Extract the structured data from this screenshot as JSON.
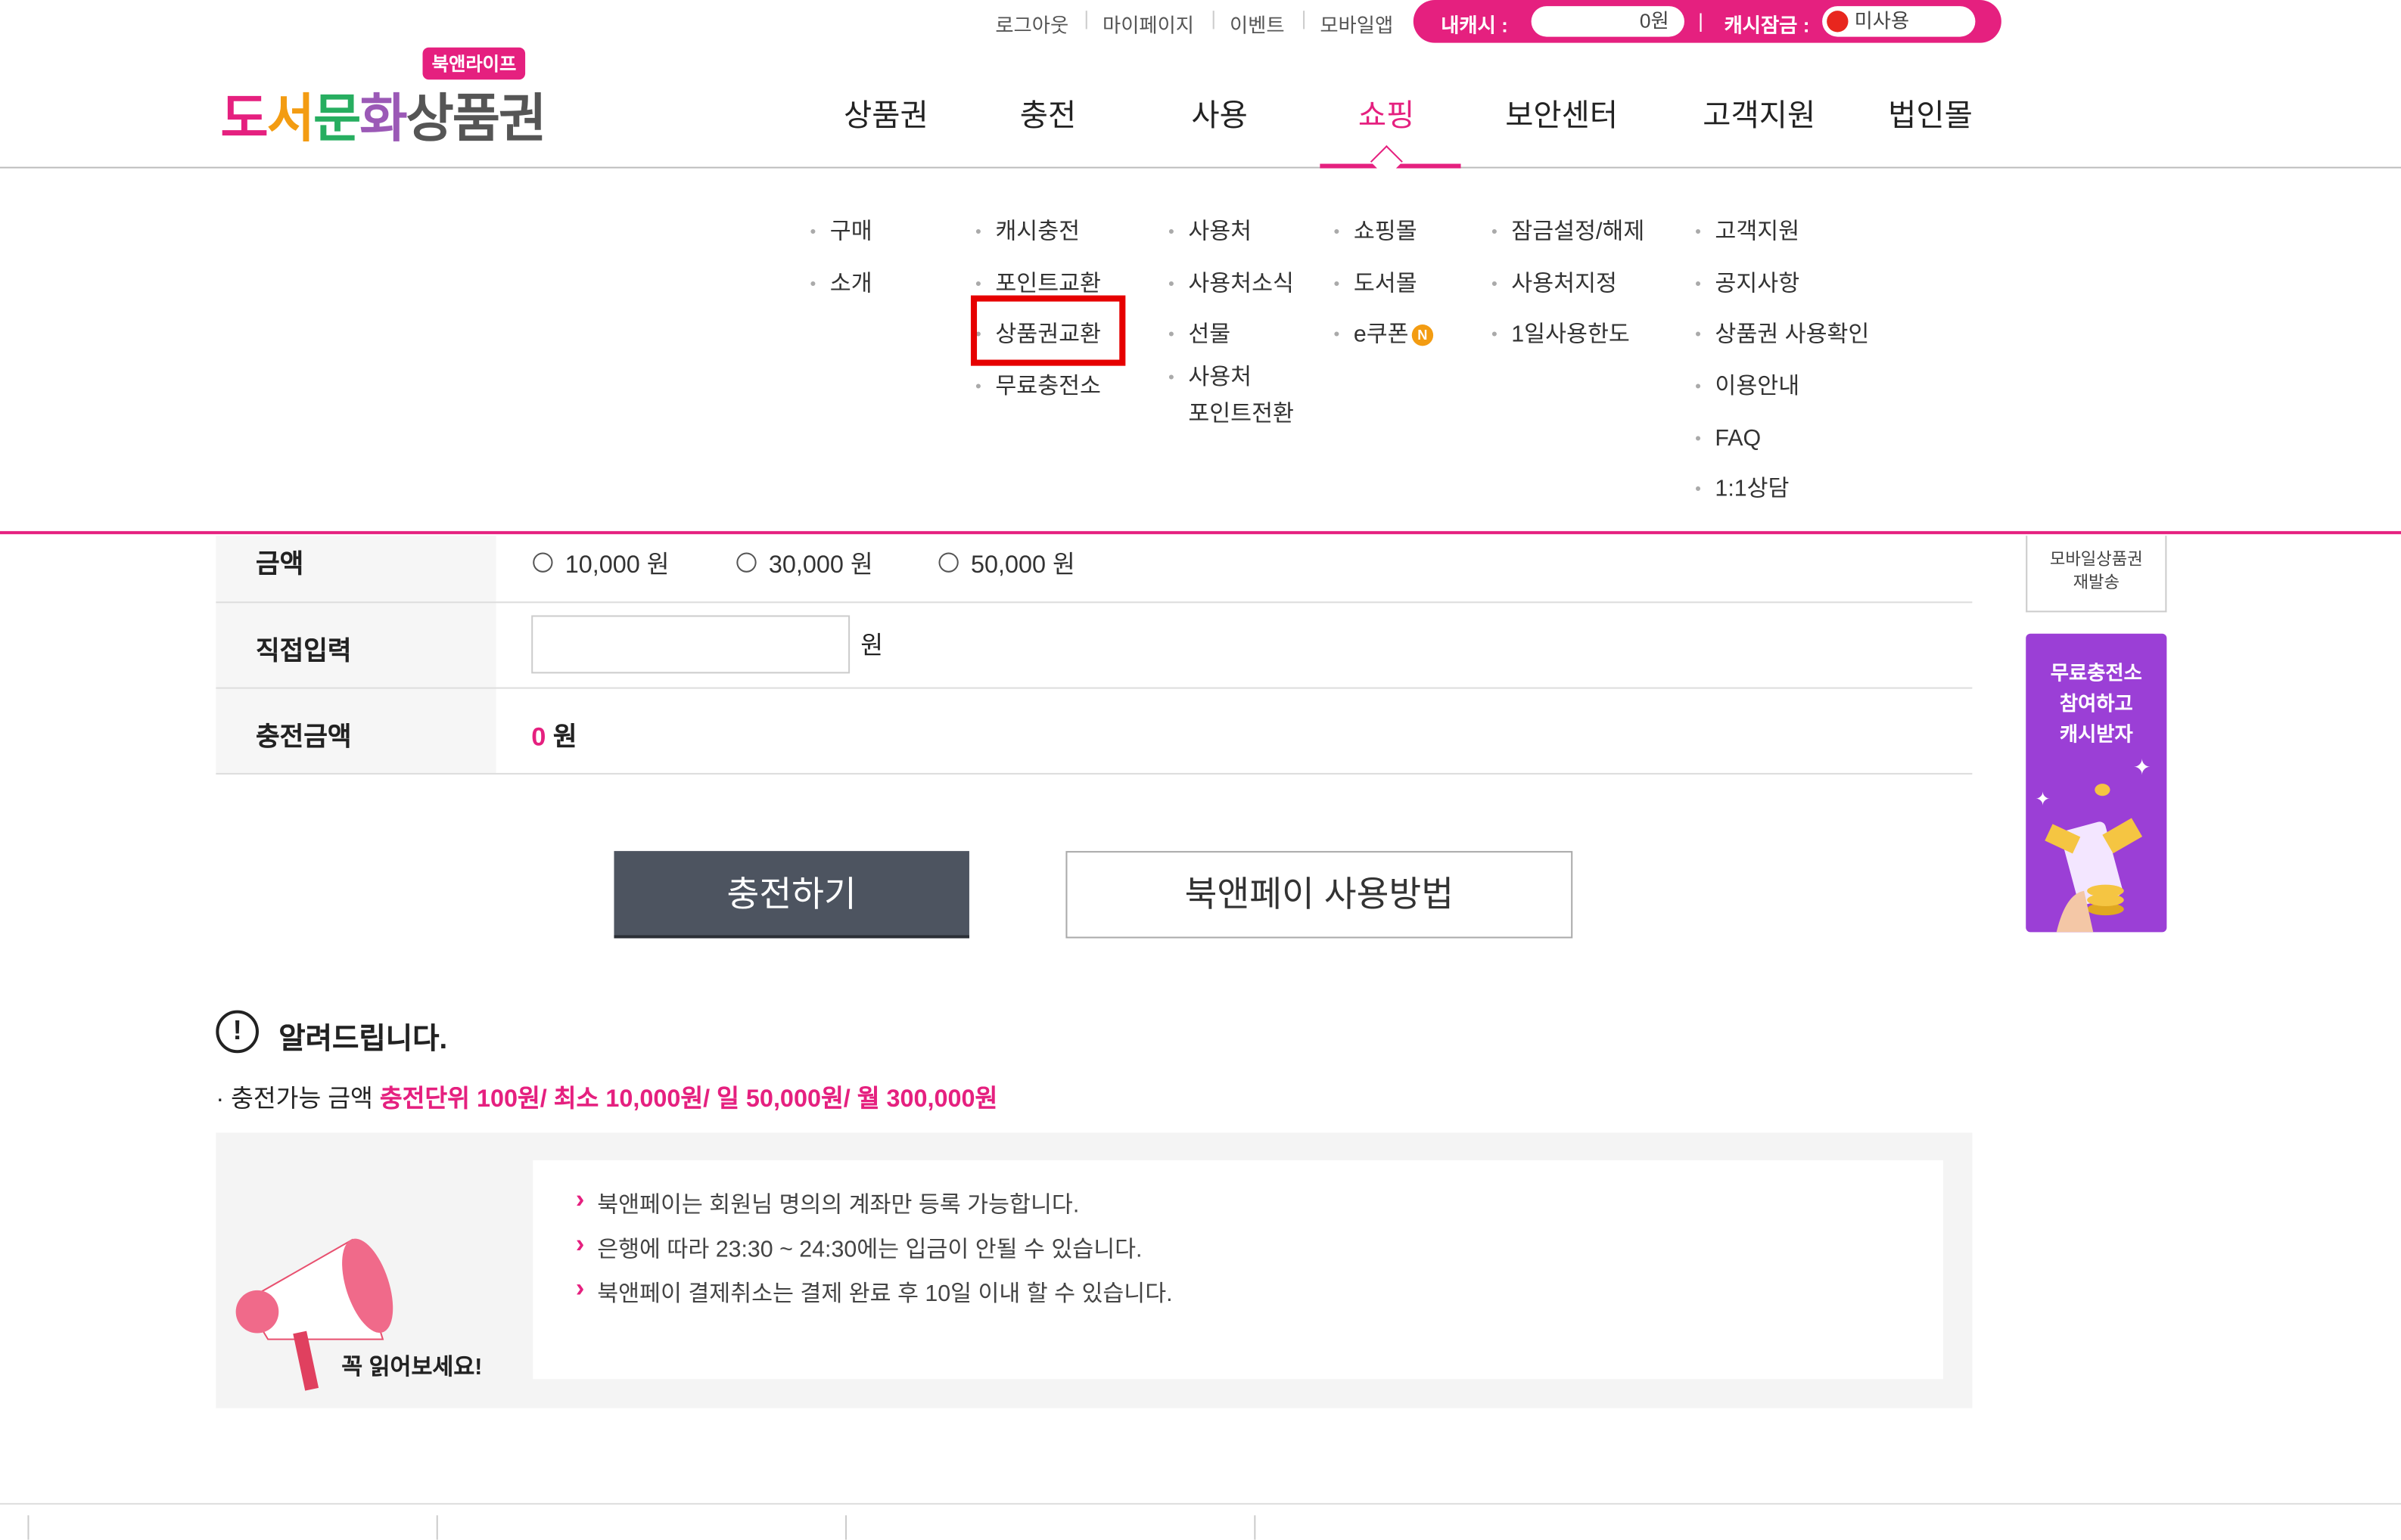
{
  "topbar": {
    "links": [
      "로그아웃",
      "마이페이지",
      "이벤트",
      "모바일앱"
    ],
    "cash_label": "내캐시 :",
    "cash_value": "0원",
    "lock_label": "캐시잠금 :",
    "lock_value": "미사용"
  },
  "logo": {
    "main": "도서문화상품권",
    "badge": "북앤라이프"
  },
  "nav": {
    "items": [
      "상품권",
      "충전",
      "사용",
      "쇼핑",
      "보안센터",
      "고객지원",
      "법인몰"
    ],
    "active": "쇼핑"
  },
  "submenu": {
    "col1": [
      "구매",
      "소개"
    ],
    "col2": [
      "캐시충전",
      "포인트교환",
      "상품권교환",
      "무료충전소"
    ],
    "col3": [
      "사용처",
      "사용처소식",
      "선물",
      "사용처",
      "포인트전환"
    ],
    "col4": [
      "쇼핑몰",
      "도서몰",
      "e쿠폰"
    ],
    "col4_badge": "N",
    "col5": [
      "잠금설정/해제",
      "사용처지정",
      "1일사용한도"
    ],
    "col6": [
      "고객지원",
      "공지사항",
      "상품권 사용확인",
      "이용안내",
      "FAQ",
      "1:1상담"
    ],
    "highlighted": "상품권교환"
  },
  "form": {
    "amount_label": "금액",
    "amount_options": [
      "10,000 원",
      "30,000 원",
      "50,000 원"
    ],
    "direct_label": "직접입력",
    "direct_unit": "원",
    "total_label": "충전금액",
    "total_value": "0",
    "total_unit": "원"
  },
  "buttons": {
    "charge": "충전하기",
    "howto": "북앤페이 사용방법"
  },
  "notice": {
    "title": "알려드립니다.",
    "line_prefix": "· 충전가능 금액 ",
    "line_highlight": "충전단위 100원/ 최소 10,000원/ 일 50,000원/ 월 300,000원",
    "must_read": "꼭 읽어보세요!",
    "items": [
      "북앤페이는 회원님 명의의 계좌만 등록 가능합니다.",
      "은행에 따라 23:30 ~ 24:30에는 입금이 안될 수 있습니다.",
      "북앤페이 결제취소는 결제 완료 후 10일 이내 할 수 있습니다."
    ]
  },
  "side": {
    "mobile_resend": [
      "모바일상품권",
      "재발송"
    ],
    "free_charge": [
      "무료충전소",
      "참여하고",
      "캐시받자"
    ]
  },
  "colors": {
    "brand": "#e5207f",
    "highlight_box": "#e60000",
    "charge_button": "#4d5460",
    "side_banner": "#9b3fd6"
  }
}
